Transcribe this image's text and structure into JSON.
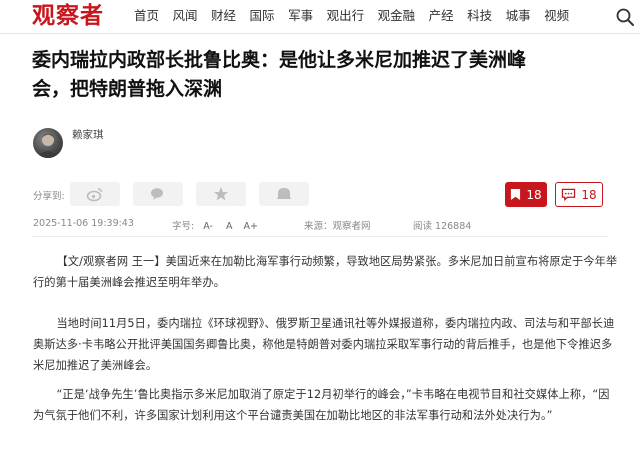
{
  "site": {
    "logo": "观察者"
  },
  "nav": {
    "items": [
      "首页",
      "风闻",
      "财经",
      "国际",
      "军事",
      "观出行",
      "观金融",
      "产经",
      "科技",
      "城事",
      "视频"
    ]
  },
  "article": {
    "title_line1": "委内瑞拉内政部长批鲁比奥：是他让多米尼加推迟了美洲峰",
    "title_line2": "会，把特朗普拖入深渊",
    "author": "赖家琪",
    "share_label": "分享到:",
    "like_count": "18",
    "comment_count": "18",
    "datetime": "2025-11-06 19:39:43",
    "font_size_label": "字号:",
    "font_small": "A-",
    "font_medium": "A",
    "font_large": "A+",
    "source": "来源：观察者网",
    "reads": "阅读 126884",
    "paragraphs": [
      {
        "lead": "【文/观察者网 王一】",
        "text": "美国近来在加勒比海军事行动频繁，导致地区局势紧张。多米尼加日前宣布将原定于今年举行的第十届美洲峰会推迟至明年举办。"
      },
      {
        "lead": "",
        "text": "当地时间11月5日，委内瑞拉《环球视野》、俄罗斯卫星通讯社等外媒报道称，委内瑞拉内政、司法与和平部长迪奥斯达多·卡韦略公开批评美国国务卿鲁比奥，称他是特朗普对委内瑞拉采取军事行动的背后推手，也是他下令推迟多米尼加推迟了美洲峰会。"
      },
      {
        "lead": "",
        "text": "“正是‘战争先生’鲁比奥指示多米尼加取消了原定于12月初举行的峰会，”卡韦略在电视节目和社交媒体上称，“因为气氛于他们不利，许多国家计划利用这个平台谴责美国在加勒比地区的非法军事行动和法外处决行为。”"
      }
    ]
  },
  "colors": {
    "brand": "#c8161d",
    "text": "#222222",
    "muted": "#888888"
  },
  "icons": [
    "search-icon",
    "weibo-icon",
    "wechat-icon",
    "qzone-star-icon",
    "more-share-icon",
    "bookmark-icon",
    "comment-icon"
  ]
}
